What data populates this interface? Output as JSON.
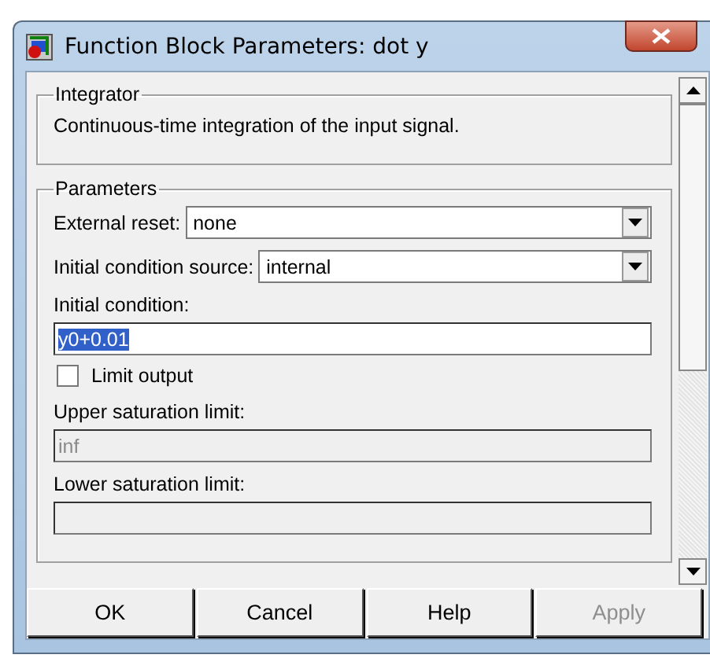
{
  "window": {
    "title": "Function Block Parameters: dot y"
  },
  "description_group": {
    "title": "Integrator",
    "text": "Continuous-time integration of the input signal."
  },
  "parameters": {
    "title": "Parameters",
    "fields": [
      {
        "kind": "dropdown",
        "label": "External reset:",
        "value": "none"
      },
      {
        "kind": "dropdown",
        "label": "Initial condition source:",
        "value": "internal"
      },
      {
        "kind": "text",
        "label": "Initial condition:",
        "value": "y0+0.01",
        "selected": true,
        "disabled": false
      },
      {
        "kind": "checkbox",
        "label": "Limit output",
        "checked": false
      },
      {
        "kind": "text",
        "label": "Upper saturation limit:",
        "value": "inf",
        "selected": false,
        "disabled": true
      },
      {
        "kind": "text",
        "label": "Lower saturation limit:",
        "disabled": true
      }
    ]
  },
  "buttons": [
    {
      "label": "OK",
      "disabled": false
    },
    {
      "label": "Cancel",
      "disabled": false
    },
    {
      "label": "Help",
      "disabled": false
    },
    {
      "label": "Apply",
      "disabled": true
    }
  ]
}
